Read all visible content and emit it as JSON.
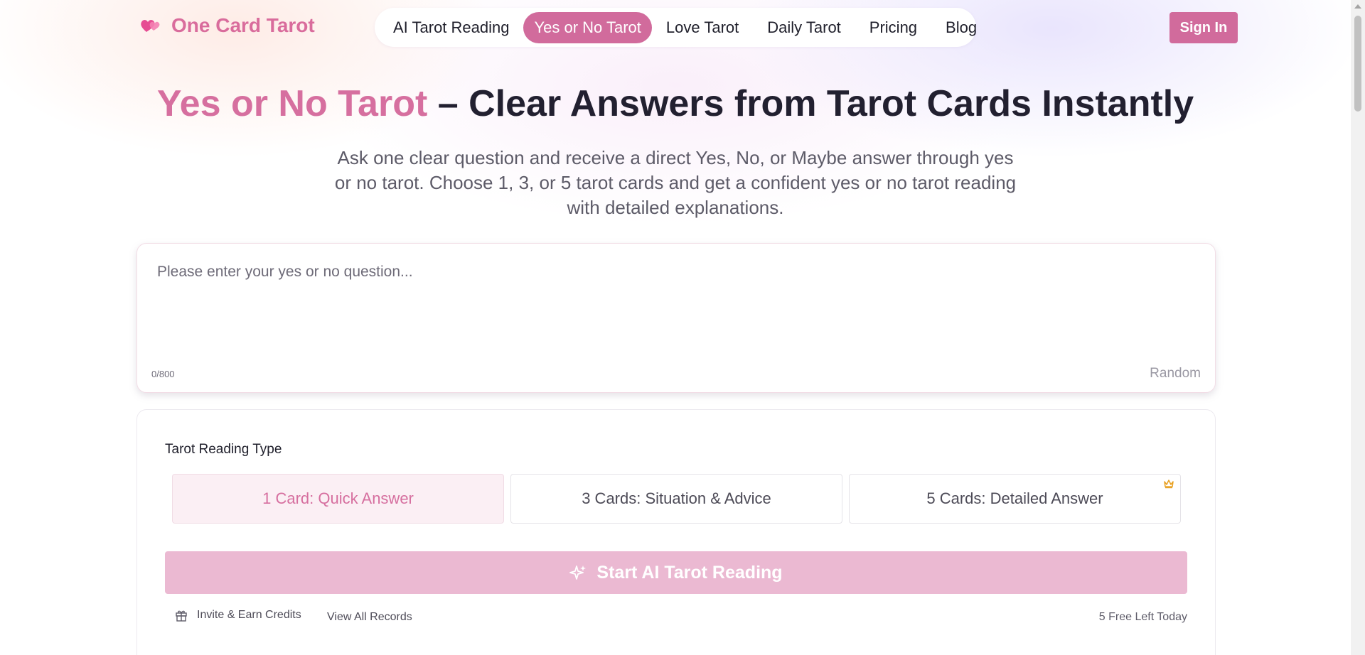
{
  "brand": {
    "name": "One Card Tarot",
    "accent_color": "#d16b9c"
  },
  "nav": {
    "items": [
      {
        "label": "AI Tarot Reading",
        "active": false
      },
      {
        "label": "Yes or No Tarot",
        "active": true
      },
      {
        "label": "Love Tarot",
        "active": false
      },
      {
        "label": "Daily Tarot",
        "active": false
      },
      {
        "label": "Pricing",
        "active": false
      },
      {
        "label": "Blog",
        "active": false
      }
    ],
    "signin_label": "Sign In"
  },
  "hero": {
    "title_accent": "Yes or No Tarot",
    "title_rest": " – Clear Answers from Tarot Cards Instantly",
    "subtitle": "Ask one clear question and receive a direct Yes, No, or Maybe answer through yes or no tarot. Choose 1, 3, or 5 tarot cards and get a confident yes or no tarot reading with detailed explanations."
  },
  "question": {
    "placeholder": "Please enter your yes or no question...",
    "value": "",
    "counter": "0/800",
    "random_label": "Random"
  },
  "reading": {
    "label": "Tarot Reading Type",
    "options": [
      {
        "label": "1 Card: Quick Answer",
        "selected": true
      },
      {
        "label": "3 Cards: Situation & Advice",
        "selected": false
      },
      {
        "label": "5 Cards: Detailed Answer",
        "selected": false,
        "icon": "crown-icon"
      }
    ],
    "start_label": "Start AI Tarot Reading",
    "invite_label": "Invite & Earn Credits",
    "records_label": "View All Records",
    "free_left": "5 Free Left Today"
  }
}
